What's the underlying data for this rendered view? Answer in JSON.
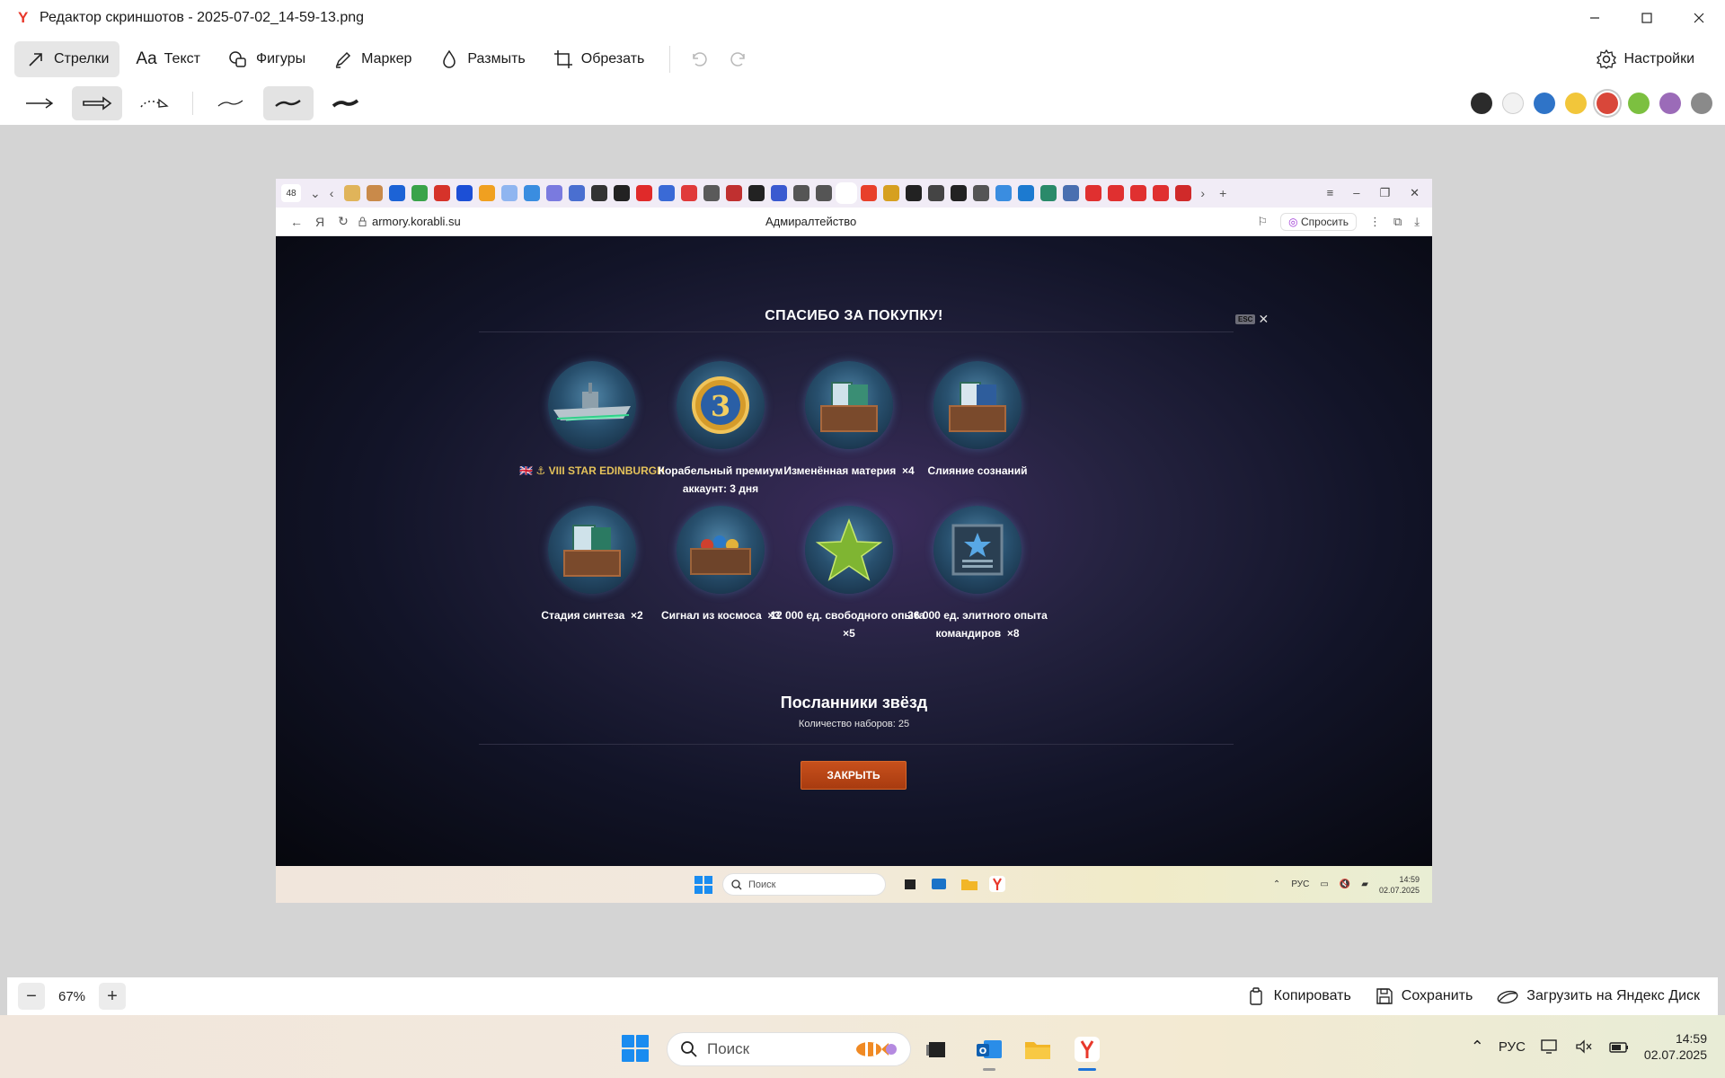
{
  "window": {
    "title": "Редактор скриншотов - 2025-07-02_14-59-13.png",
    "app_icon": "yandex-y-icon"
  },
  "toolbar": {
    "tools": [
      {
        "id": "arrows",
        "label": "Стрелки",
        "icon": "arrow-icon",
        "active": true
      },
      {
        "id": "text",
        "label": "Текст",
        "icon": "text-icon",
        "active": false
      },
      {
        "id": "shapes",
        "label": "Фигуры",
        "icon": "shapes-icon",
        "active": false
      },
      {
        "id": "marker",
        "label": "Маркер",
        "icon": "marker-icon",
        "active": false
      },
      {
        "id": "blur",
        "label": "Размыть",
        "icon": "drop-icon",
        "active": false
      },
      {
        "id": "crop",
        "label": "Обрезать",
        "icon": "crop-icon",
        "active": false
      }
    ],
    "settings_label": "Настройки"
  },
  "palette": [
    "#2b2b2b",
    "#f2f2f2",
    "#2f74c8",
    "#f2c63a",
    "#d9473a",
    "#7cc040",
    "#9b6bb8",
    "#8a8a8a"
  ],
  "palette_selected": "#d9473a",
  "bottombar": {
    "zoom": "67%",
    "copy_label": "Копировать",
    "save_label": "Сохранить",
    "upload_label": "Загрузить на Яндекс Диск"
  },
  "taskbar": {
    "search_placeholder": "Поиск",
    "lang": "РУС",
    "time": "14:59",
    "date": "02.07.2025"
  },
  "screenshot": {
    "browser": {
      "tab_count": "48",
      "url": "armory.korabli.su",
      "page_title": "Адмиралтейство",
      "ask_label": "Спросить"
    },
    "modal": {
      "title": "СПАСИБО ЗА ПОКУПКУ!",
      "esc": "ESC",
      "close_glyph": "✕",
      "rewards": [
        {
          "label_gold": "VIII STAR EDINBURGH",
          "label": "",
          "qty": ""
        },
        {
          "label_gold": "",
          "label": "Корабельный премиум аккаунт: 3 дня",
          "qty": ""
        },
        {
          "label_gold": "",
          "label": "Изменённая материя",
          "qty": "×4"
        },
        {
          "label_gold": "",
          "label": "Слияние сознаний",
          "qty": ""
        },
        {
          "label_gold": "",
          "label": "Стадия синтеза",
          "qty": "×2"
        },
        {
          "label_gold": "",
          "label": "Сигнал из космоса",
          "qty": "×3"
        },
        {
          "label_gold": "",
          "label": "12 000 ед. свободного опыта",
          "qty": "×5"
        },
        {
          "label_gold": "",
          "label": "36 000 ед. элитного опыта командиров",
          "qty": "×8"
        }
      ],
      "premium_number": "3",
      "bundle_name": "Посланники звёзд",
      "bundle_count": "Количество наборов: 25",
      "close_button": "ЗАКРЫТЬ"
    },
    "taskbar": {
      "search_placeholder": "Поиск",
      "lang": "РУС",
      "time": "14:59",
      "date": "02.07.2025"
    }
  }
}
